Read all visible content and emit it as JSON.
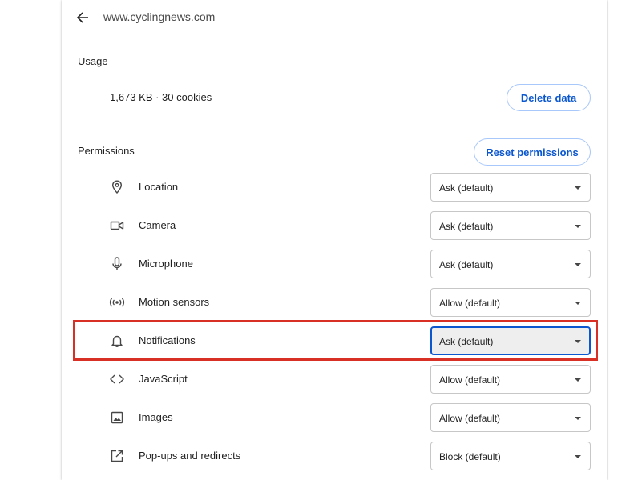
{
  "header": {
    "back_icon": "arrow-back-icon",
    "site": "www.cyclingnews.com"
  },
  "usage": {
    "label": "Usage",
    "summary": "1,673 KB · 30 cookies",
    "delete_label": "Delete data"
  },
  "permissions": {
    "label": "Permissions",
    "reset_label": "Reset permissions",
    "items": [
      {
        "label": "Location",
        "value": "Ask (default)",
        "icon": "location-pin-icon"
      },
      {
        "label": "Camera",
        "value": "Ask (default)",
        "icon": "camera-icon"
      },
      {
        "label": "Microphone",
        "value": "Ask (default)",
        "icon": "microphone-icon"
      },
      {
        "label": "Motion sensors",
        "value": "Allow (default)",
        "icon": "motion-sensors-icon"
      },
      {
        "label": "Notifications",
        "value": "Ask (default)",
        "icon": "bell-icon"
      },
      {
        "label": "JavaScript",
        "value": "Allow (default)",
        "icon": "code-icon"
      },
      {
        "label": "Images",
        "value": "Allow (default)",
        "icon": "image-icon"
      },
      {
        "label": "Pop-ups and redirects",
        "value": "Block (default)",
        "icon": "open-in-new-icon"
      }
    ]
  },
  "colors": {
    "accent": "#0b57d0",
    "button_border": "#a8c7fa",
    "highlight": "#d93025"
  }
}
